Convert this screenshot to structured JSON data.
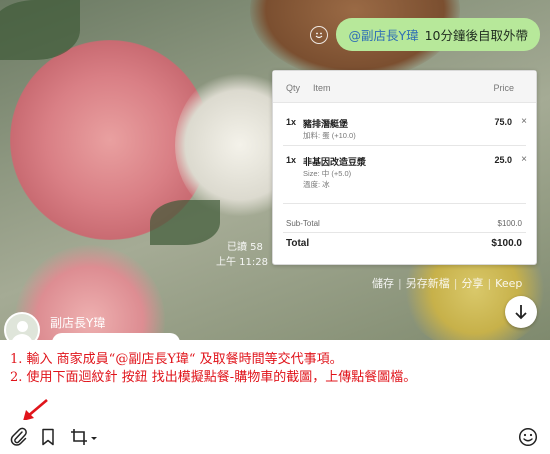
{
  "sent_message": {
    "mention": "@副店長Y瑋",
    "text": "10分鐘後自取外帶"
  },
  "order": {
    "headers": {
      "qty": "Qty",
      "item": "Item",
      "price": "Price"
    },
    "items": [
      {
        "qty": "1x",
        "name": "豬排潛艇堡",
        "price": "75.0",
        "remove": "×",
        "mods": [
          "加料: 蛋 (+10.0)"
        ]
      },
      {
        "qty": "1x",
        "name": "非基因改造豆漿",
        "price": "25.0",
        "remove": "×",
        "mods": [
          "Size: 中 (+5.0)",
          "溫度: 冰"
        ]
      }
    ],
    "subtotal_label": "Sub-Total",
    "subtotal_value": "$100.0",
    "total_label": "Total",
    "total_value": "$100.0"
  },
  "message_meta": {
    "read": "已讀 58",
    "time": "上午 11:28"
  },
  "actions": [
    "儲存",
    "另存新檔",
    "分享",
    "Keep"
  ],
  "action_separator": "|",
  "received": {
    "sender": "副店長Y瑋"
  },
  "instructions": [
    "1. 輸入 商家成員“@副店長Y瑋“ 及取餐時間等交代事項。",
    "2. 使用下面迴紋針 按鈕 找出模擬點餐-購物車的截圖，上傳點餐圖檔。"
  ],
  "colors": {
    "bubble": "#b7e89a",
    "mention": "#2f6fb5",
    "instruction": "#e0141b"
  },
  "toolbar_icons": [
    "paperclip-icon",
    "bookmark-icon",
    "crop-icon",
    "emoji-icon"
  ]
}
